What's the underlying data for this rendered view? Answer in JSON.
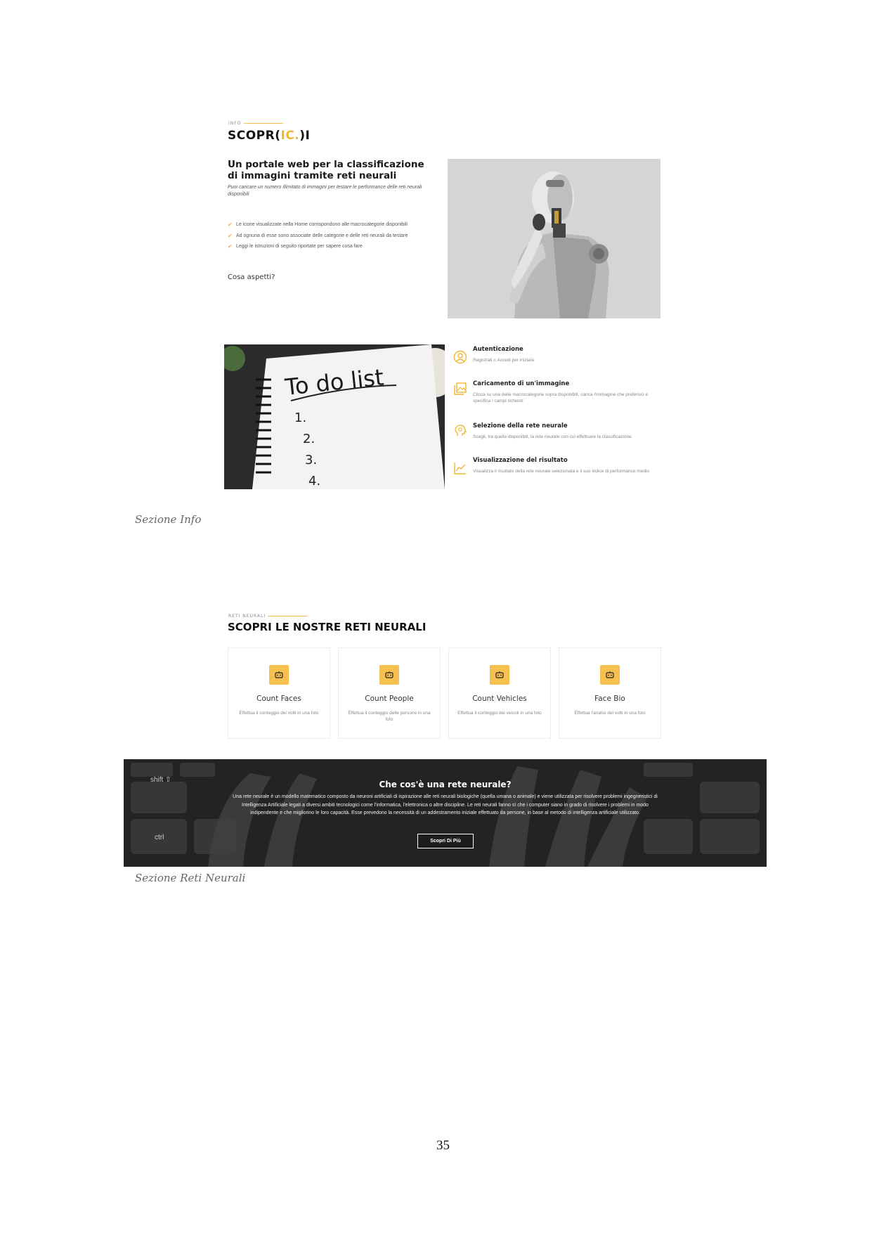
{
  "info": {
    "eyebrow": "INFO",
    "brand_prefix": "SCOPR(",
    "brand_accent": "IC.",
    "brand_suffix": ")I",
    "headline": "Un portale web per la classificazione di immagini tramite reti neurali",
    "subtitle": "Puoi caricare un numero illimitato di immagini per testare le performance delle reti neurali disponibili",
    "bullets": [
      "Le icone visualizzate nella Home corrispondono alle macrocategorie disponibili",
      "Ad ognuna di esse sono associate delle categorie e delle reti neurali da testare",
      "Leggi le istruzioni di seguito riportate per sapere cosa fare"
    ],
    "question": "Cosa aspetti?",
    "todo_image_text": "To do list",
    "todo_numbers": [
      "1.",
      "2.",
      "3.",
      "4."
    ],
    "steps": [
      {
        "title": "Autenticazione",
        "desc": "Registrati o Accedi per iniziare",
        "icon": "user-circle-icon"
      },
      {
        "title": "Caricamento di un'immagine",
        "desc": "Clicca su una delle macrocategorie sopra disponibili, carica l'immagine che preferisci e specifica i campi richiesti",
        "icon": "image-upload-icon"
      },
      {
        "title": "Selezione della rete neurale",
        "desc": "Scegli, tra quelle disponibili, la rete neurale con cui effettuare la classificazione",
        "icon": "brain-bulb-icon"
      },
      {
        "title": "Visualizzazione del risultato",
        "desc": "Visualizza il risultato della rete neurale selezionata e il suo indice di performance medio",
        "icon": "line-chart-icon"
      }
    ],
    "caption": "Sezione Info"
  },
  "networks": {
    "eyebrow": "RETI NEURALI",
    "title": "SCOPRI LE NOSTRE RETI NEURALI",
    "cards": [
      {
        "title": "Count Faces",
        "desc": "Effettua il conteggio dei volti in una foto"
      },
      {
        "title": "Count People",
        "desc": "Effettua il conteggio delle persone in una foto"
      },
      {
        "title": "Count Vehicles",
        "desc": "Effettua il conteggio dei veicoli in una foto"
      },
      {
        "title": "Face Bio",
        "desc": "Effettua l'analisi dei volti in una foto"
      }
    ],
    "banner_title": "Che cos'è una rete neurale?",
    "banner_text": "Una rete neurale è un modello matematico composto da neuroni artificiali di ispirazione alle reti neurali biologiche (quella umana o animale) e viene utilizzata per risolvere problemi ingegneristici di Intelligenza Artificiale legati a diversi ambiti tecnologici come l'informatica, l'elettronica o altre discipline. Le reti neurali fanno sì che i computer siano in grado di risolvere i problemi in modo indipendente e che migliorino le loro capacità. Esse prevedono la necessità di un addestramento iniziale effettuato da persone, in base al metodo di intelligenza artificiale utilizzato.",
    "banner_button": "Scopri Di Più",
    "key_shift": "shift ⇧",
    "key_ctrl": "ctrl",
    "caption": "Sezione Reti Neurali"
  },
  "page_number": "35",
  "colors": {
    "accent": "#f2b632",
    "card_icon": "#f5c04f"
  }
}
